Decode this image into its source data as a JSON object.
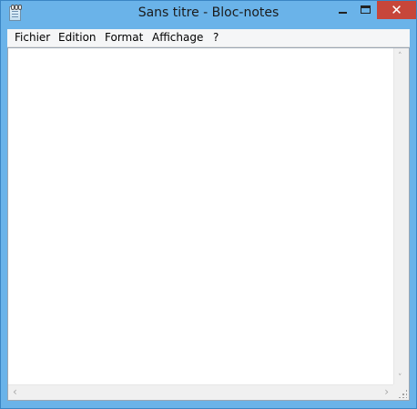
{
  "window": {
    "title": "Sans titre - Bloc-notes",
    "frame_color": "#6ab3e9",
    "close_color": "#c7463a"
  },
  "titlebar": {
    "app_icon": "notepad-icon",
    "minimize_icon": "minimize-icon",
    "maximize_icon": "maximize-icon",
    "close_icon": "close-icon",
    "close_glyph": "✕"
  },
  "menu": {
    "items": [
      {
        "label": "Fichier"
      },
      {
        "label": "Edition"
      },
      {
        "label": "Format"
      },
      {
        "label": "Affichage"
      },
      {
        "label": "?"
      }
    ]
  },
  "editor": {
    "content": ""
  },
  "scrollbars": {
    "up_arrow": "˄",
    "down_arrow": "˅",
    "left_arrow": "‹",
    "right_arrow": "›"
  }
}
